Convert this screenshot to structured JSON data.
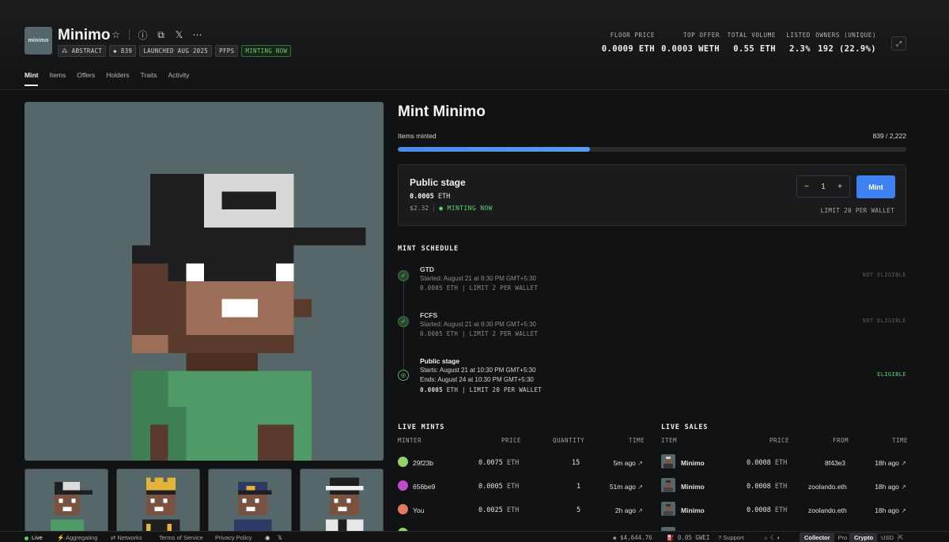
{
  "collection": {
    "logo_text": "minimo",
    "name": "Minimo",
    "badges": [
      "ABSTRACT",
      "839",
      "LAUNCHED AUG 2025",
      "PFPS",
      "MINTING NOW"
    ]
  },
  "stats": [
    {
      "label": "FLOOR PRICE",
      "value": "0.0009 ETH"
    },
    {
      "label": "TOP OFFER",
      "value": "0.0003 WETH"
    },
    {
      "label": "TOTAL VOLUME",
      "value": "0.55 ETH"
    },
    {
      "label": "LISTED",
      "value": "2.3%"
    },
    {
      "label": "OWNERS (UNIQUE)",
      "value": "192 (22.9%)"
    }
  ],
  "tabs": [
    "Mint",
    "Items",
    "Offers",
    "Holders",
    "Traits",
    "Activity"
  ],
  "mint": {
    "title": "Mint Minimo",
    "minted_label": "Items minted",
    "minted_value": "839 / 2,222",
    "progress_fraction": 0.3776,
    "stage": {
      "name": "Public stage",
      "price_value": "0.0005",
      "price_unit": "ETH",
      "usd": "$2.32",
      "status": "MINTING NOW",
      "quantity": "1",
      "button": "Mint",
      "limit": "LIMIT 20 PER WALLET"
    }
  },
  "schedule": {
    "heading": "MINT SCHEDULE",
    "items": [
      {
        "name": "GTD",
        "line1": "Started: August 21 at 8:30 PM GMT+5:30",
        "price": "0.0005",
        "detail": "ETH | LIMIT 2 PER WALLET",
        "status": "NOT ELIGIBLE"
      },
      {
        "name": "FCFS",
        "line1": "Started: August 21 at 9:30 PM GMT+5:30",
        "price": "0.0005",
        "detail": "ETH | LIMIT 2 PER WALLET",
        "status": "NOT ELIGIBLE"
      },
      {
        "name": "Public stage",
        "line1": "Starts: August 21 at 10:30 PM GMT+5:30",
        "line1b": "Ends: August 24 at 10:30 PM GMT+5:30",
        "price": "0.0005",
        "detail": "ETH | LIMIT 20 PER WALLET",
        "status": "ELIGIBLE"
      }
    ]
  },
  "live_mints": {
    "heading": "LIVE MINTS",
    "columns": [
      "MINTER",
      "PRICE",
      "QUANTITY",
      "TIME"
    ],
    "rows": [
      {
        "minter": "29f23b",
        "price": "0.0075",
        "unit": "ETH",
        "quantity": "15",
        "time": "5m ago",
        "avatar_color": "#8fd26a"
      },
      {
        "minter": "656be9",
        "price": "0.0005",
        "unit": "ETH",
        "quantity": "1",
        "time": "51m ago",
        "avatar_color": "#c04ad0"
      },
      {
        "minter": "You",
        "price": "0.0025",
        "unit": "ETH",
        "quantity": "5",
        "time": "2h ago",
        "avatar_color": "#e07a5f"
      }
    ]
  },
  "live_sales": {
    "heading": "LIVE SALES",
    "columns": [
      "ITEM",
      "PRICE",
      "FROM",
      "TIME"
    ],
    "rows": [
      {
        "item": "Minimo",
        "price": "0.0008",
        "unit": "ETH",
        "from": "8f43e3",
        "time": "18h ago"
      },
      {
        "item": "Minimo",
        "price": "0.0008",
        "unit": "ETH",
        "from": "zoolando.eth",
        "time": "18h ago"
      },
      {
        "item": "Minimo",
        "price": "0.0008",
        "unit": "ETH",
        "from": "zoolando.eth",
        "time": "18h ago"
      }
    ]
  },
  "footer": {
    "live": "Live",
    "aggregating": "Aggregating",
    "networks": "Networks",
    "terms": "Terms of Service",
    "privacy": "Privacy Policy",
    "eth_price": "$4,644.76",
    "gas": "0.05 GWEI",
    "support": "Support",
    "mode_a": "Collector",
    "mode_b": "Pro",
    "cur_a": "Crypto",
    "cur_b": "USD"
  },
  "colors": {
    "accent": "#3d82f0",
    "live_green": "#5fd16e",
    "art_bg": "#566769"
  }
}
